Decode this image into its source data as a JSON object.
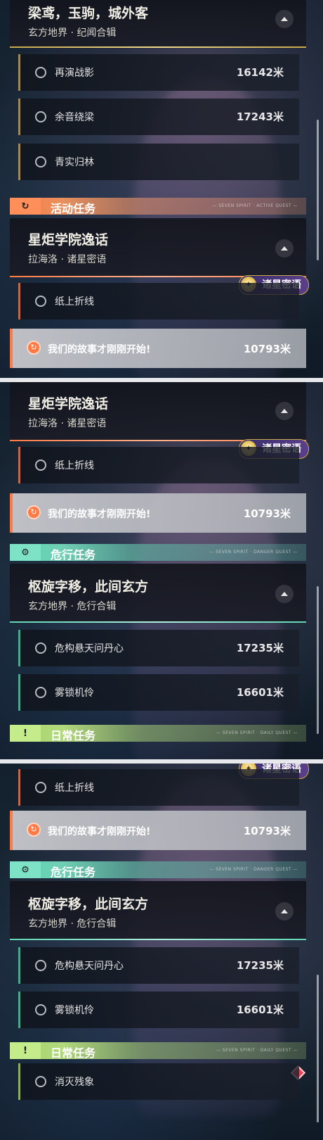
{
  "colors": {
    "accent_orange": "#ff7a45",
    "accent_teal": "#5fd6b5",
    "accent_green": "#a6d86a",
    "gold": "#c9a84a"
  },
  "icons": {
    "expand": "chevron-up-icon",
    "activity": "activity-quest-icon",
    "danger": "danger-quest-icon",
    "daily": "daily-quest-icon",
    "badge": "star-emblem-icon",
    "track": "tracking-icon"
  },
  "panel1": {
    "header": {
      "title": "梁鸢，玉驹，城外客",
      "subtitle": "玄方地界 · 纪闻合辑"
    },
    "rows": [
      {
        "name": "再演战影",
        "distance": "16142米"
      },
      {
        "name": "余音绕梁",
        "distance": "17243米"
      },
      {
        "name": "青实归林",
        "distance": ""
      }
    ],
    "category": {
      "label": "活动任务",
      "tiny": "— SEVEN SPIRIT · ACTIVE QUEST —"
    },
    "header2": {
      "title": "星炬学院逸话",
      "subtitle": "拉海洛 · 诸星密语"
    },
    "badge": "诸星密语",
    "row4": {
      "name": "纸上折线",
      "distance": ""
    },
    "active": {
      "name": "我们的故事才刚刚开始!",
      "distance": "10793米"
    }
  },
  "panel2": {
    "header": {
      "title": "星炬学院逸话",
      "subtitle": "拉海洛 · 诸星密语"
    },
    "badge": "诸星密语",
    "row1": {
      "name": "纸上折线",
      "distance": ""
    },
    "active": {
      "name": "我们的故事才刚刚开始!",
      "distance": "10793米"
    },
    "category": {
      "label": "危行任务",
      "tiny": "— SEVEN SPIRIT · DANGER QUEST —"
    },
    "header2": {
      "title": "枢旋字移，此间玄方",
      "subtitle": "玄方地界 · 危行合辑"
    },
    "rows": [
      {
        "name": "危构悬天问丹心",
        "distance": "17235米"
      },
      {
        "name": "雾锁机伶",
        "distance": "16601米"
      }
    ],
    "category2": {
      "label": "日常任务",
      "tiny": "— SEVEN SPIRIT · DAILY QUEST —"
    }
  },
  "panel3": {
    "badge": "诸星密语",
    "row1": {
      "name": "纸上折线",
      "distance": ""
    },
    "active": {
      "name": "我们的故事才刚刚开始!",
      "distance": "10793米"
    },
    "category": {
      "label": "危行任务",
      "tiny": "— SEVEN SPIRIT · DANGER QUEST —"
    },
    "header": {
      "title": "枢旋字移，此间玄方",
      "subtitle": "玄方地界 · 危行合辑"
    },
    "rows": [
      {
        "name": "危构悬天问丹心",
        "distance": "17235米"
      },
      {
        "name": "雾锁机伶",
        "distance": "16601米"
      }
    ],
    "category2": {
      "label": "日常任务",
      "tiny": "— SEVEN SPIRIT · DAILY QUEST —"
    },
    "row_last": {
      "name": "消灭残象",
      "distance": ""
    }
  }
}
